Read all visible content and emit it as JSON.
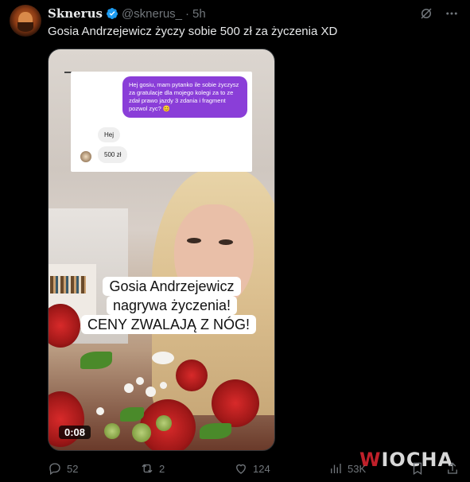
{
  "post": {
    "author_name": "Sknerus",
    "handle": "@sknerus_",
    "separator": "·",
    "time": "5h",
    "text": "Gosia Andrzejewicz życzy sobie 500 zł za życzenia XD"
  },
  "media": {
    "chat_message_out": "Hej gosiu, mam pytanko ile sobie życzysz za gratulacje dla mojego kolegi za to ze zdał prawo jazdy 3 zdania i fragment pozwol zyc? 😊",
    "chat_message_in_1": "Hej",
    "chat_message_in_2": "500 zł",
    "caption_line_1": "Gosia Andrzejewicz",
    "caption_line_2": "nagrywa życzenia!",
    "caption_line_3": "CENY ZWALAJĄ Z NÓG!",
    "duration": "0:08"
  },
  "actions": {
    "replies": "52",
    "reposts": "2",
    "likes": "124",
    "views": "53K"
  },
  "watermark": {
    "part1": "W",
    "part2": "IOCHA"
  },
  "icons": {
    "verified": "verified-badge-icon",
    "grok": "grok-icon",
    "more": "more-icon",
    "reply": "reply-icon",
    "repost": "repost-icon",
    "like": "heart-icon",
    "views": "views-icon",
    "bookmark": "bookmark-icon",
    "share": "share-icon"
  },
  "colors": {
    "background": "#000000",
    "text": "#e7e9ea",
    "muted": "#71767b",
    "verified": "#1d9bf0",
    "chat_bubble": "#8a3ed8"
  }
}
